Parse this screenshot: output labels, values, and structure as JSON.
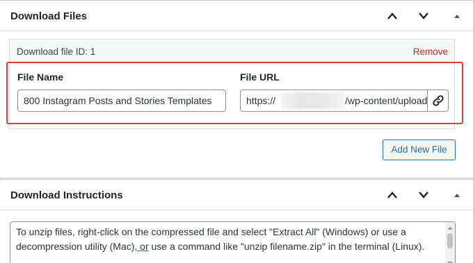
{
  "downloads_panel": {
    "title": "Download Files",
    "move_up_icon": "chevron-up-icon",
    "move_down_icon": "chevron-down-icon",
    "toggle_icon": "caret-up-icon",
    "file_entry": {
      "id_label": "Download file ID: 1",
      "remove_label": "Remove",
      "file_name_label": "File Name",
      "file_name_value": "800 Instagram Posts and Stories Templates",
      "file_url_label": "File URL",
      "file_url_prefix": "https://",
      "file_url_suffix": "/wp-content/uploads",
      "link_icon": "link-icon"
    },
    "add_new_label": "Add New File"
  },
  "instructions_panel": {
    "title": "Download Instructions",
    "text_part1": "To unzip files, right-click on the compressed file and select \"Extract All\" (Windows) or use a decompression utility (Mac)",
    "text_part2": ", or",
    "text_part3": " use a command like \"unzip filename.zip\" in the terminal (Linux)."
  },
  "colors": {
    "highlight": "#e2393a",
    "accent": "#2271b1",
    "remove": "#b32d2e"
  }
}
